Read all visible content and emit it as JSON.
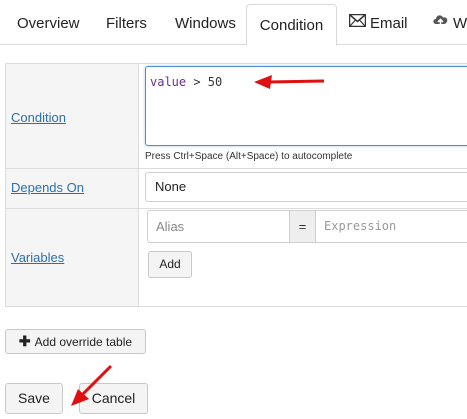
{
  "tabs": [
    {
      "label": "Overview"
    },
    {
      "label": "Filters"
    },
    {
      "label": "Windows"
    },
    {
      "label": "Condition",
      "active": true
    },
    {
      "label": "Email",
      "icon": "envelope-icon"
    },
    {
      "label": "We",
      "icon": "cloud-upload-icon"
    }
  ],
  "condition": {
    "label": "Condition",
    "code_keyword": "value",
    "code_rest": " > 50",
    "hint": "Press Ctrl+Space (Alt+Space) to autocomplete"
  },
  "depends_on": {
    "label": "Depends On",
    "selected": "None"
  },
  "variables": {
    "label": "Variables",
    "alias_placeholder": "Alias",
    "separator": "=",
    "expression_placeholder": "Expression",
    "add_label": "Add"
  },
  "buttons": {
    "override_label": "Add override table",
    "save_label": "Save",
    "cancel_label": "Cancel"
  },
  "colors": {
    "link": "#2a6fb0",
    "annotation_arrow": "#e01010",
    "focus_border": "#4a90d9"
  }
}
